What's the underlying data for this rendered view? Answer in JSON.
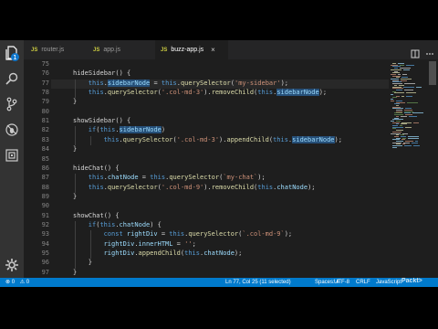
{
  "tabs": [
    {
      "icon": "JS",
      "label": "router.js",
      "active": false
    },
    {
      "icon": "JS",
      "label": "app.js",
      "active": false
    },
    {
      "icon": "JS",
      "label": "buzz-app.js",
      "active": true,
      "close": "×"
    }
  ],
  "activity_icons": [
    "files-icon",
    "search-icon",
    "git-icon",
    "debug-icon",
    "extensions-icon",
    "settings-gear-icon"
  ],
  "explorer_badge": "1",
  "editor": {
    "line_numbers": [
      "75",
      "76",
      "77",
      "78",
      "79",
      "80",
      "81",
      "82",
      "83",
      "84",
      "85",
      "86",
      "87",
      "88",
      "89",
      "90",
      "91",
      "92",
      "93",
      "94",
      "95",
      "96",
      "97"
    ],
    "lines": [
      [],
      [
        {
          "t": "hideSidebar() {",
          "c": "plain"
        }
      ],
      [
        {
          "t": "this",
          "c": "kw"
        },
        {
          "t": ".",
          "c": "plain"
        },
        {
          "t": "sidebarNode",
          "c": "hl"
        },
        {
          "t": " = ",
          "c": "plain"
        },
        {
          "t": "this",
          "c": "kw"
        },
        {
          "t": ".",
          "c": "plain"
        },
        {
          "t": "querySelector",
          "c": "fn"
        },
        {
          "t": "(",
          "c": "plain"
        },
        {
          "t": "'my-sidebar'",
          "c": "str"
        },
        {
          "t": ");",
          "c": "plain"
        }
      ],
      [
        {
          "t": "this",
          "c": "kw"
        },
        {
          "t": ".",
          "c": "plain"
        },
        {
          "t": "querySelector",
          "c": "fn"
        },
        {
          "t": "(",
          "c": "plain"
        },
        {
          "t": "'.col-md-3'",
          "c": "str"
        },
        {
          "t": ").",
          "c": "plain"
        },
        {
          "t": "removeChild",
          "c": "fn"
        },
        {
          "t": "(",
          "c": "plain"
        },
        {
          "t": "this",
          "c": "kw"
        },
        {
          "t": ".",
          "c": "plain"
        },
        {
          "t": "sidebarNode",
          "c": "hl"
        },
        {
          "t": ");",
          "c": "plain"
        }
      ],
      [
        {
          "t": "}",
          "c": "plain"
        }
      ],
      [],
      [
        {
          "t": "showSidebar() {",
          "c": "plain"
        }
      ],
      [
        {
          "t": "if",
          "c": "kw"
        },
        {
          "t": "(",
          "c": "plain"
        },
        {
          "t": "this",
          "c": "kw"
        },
        {
          "t": ".",
          "c": "plain"
        },
        {
          "t": "sidebarNode",
          "c": "hl"
        },
        {
          "t": ")",
          "c": "plain"
        }
      ],
      [
        {
          "t": "this",
          "c": "kw"
        },
        {
          "t": ".",
          "c": "plain"
        },
        {
          "t": "querySelector",
          "c": "fn"
        },
        {
          "t": "(",
          "c": "plain"
        },
        {
          "t": "'.col-md-3'",
          "c": "str"
        },
        {
          "t": ").",
          "c": "plain"
        },
        {
          "t": "appendChild",
          "c": "fn"
        },
        {
          "t": "(",
          "c": "plain"
        },
        {
          "t": "this",
          "c": "kw"
        },
        {
          "t": ".",
          "c": "plain"
        },
        {
          "t": "sidebarNode",
          "c": "hl"
        },
        {
          "t": ");",
          "c": "plain"
        }
      ],
      [
        {
          "t": "}",
          "c": "plain"
        }
      ],
      [],
      [
        {
          "t": "hideChat() {",
          "c": "plain"
        }
      ],
      [
        {
          "t": "this",
          "c": "kw"
        },
        {
          "t": ".",
          "c": "plain"
        },
        {
          "t": "chatNode",
          "c": "var"
        },
        {
          "t": " = ",
          "c": "plain"
        },
        {
          "t": "this",
          "c": "kw"
        },
        {
          "t": ".",
          "c": "plain"
        },
        {
          "t": "querySelector",
          "c": "fn"
        },
        {
          "t": "(",
          "c": "plain"
        },
        {
          "t": "`my-chat`",
          "c": "str"
        },
        {
          "t": ");",
          "c": "plain"
        }
      ],
      [
        {
          "t": "this",
          "c": "kw"
        },
        {
          "t": ".",
          "c": "plain"
        },
        {
          "t": "querySelector",
          "c": "fn"
        },
        {
          "t": "(",
          "c": "plain"
        },
        {
          "t": "'.col-md-9'",
          "c": "str"
        },
        {
          "t": ").",
          "c": "plain"
        },
        {
          "t": "removeChild",
          "c": "fn"
        },
        {
          "t": "(",
          "c": "plain"
        },
        {
          "t": "this",
          "c": "kw"
        },
        {
          "t": ".",
          "c": "plain"
        },
        {
          "t": "chatNode",
          "c": "var"
        },
        {
          "t": ");",
          "c": "plain"
        }
      ],
      [
        {
          "t": "}",
          "c": "plain"
        }
      ],
      [],
      [
        {
          "t": "showChat() {",
          "c": "plain"
        }
      ],
      [
        {
          "t": "if",
          "c": "kw"
        },
        {
          "t": "(",
          "c": "plain"
        },
        {
          "t": "this",
          "c": "kw"
        },
        {
          "t": ".",
          "c": "plain"
        },
        {
          "t": "chatNode",
          "c": "var"
        },
        {
          "t": ") {",
          "c": "plain"
        }
      ],
      [
        {
          "t": "const",
          "c": "kw"
        },
        {
          "t": " ",
          "c": "plain"
        },
        {
          "t": "rightDiv",
          "c": "var"
        },
        {
          "t": " = ",
          "c": "plain"
        },
        {
          "t": "this",
          "c": "kw"
        },
        {
          "t": ".",
          "c": "plain"
        },
        {
          "t": "querySelector",
          "c": "fn"
        },
        {
          "t": "(",
          "c": "plain"
        },
        {
          "t": "`.col-md-9`",
          "c": "str"
        },
        {
          "t": ");",
          "c": "plain"
        }
      ],
      [
        {
          "t": "rightDiv",
          "c": "var"
        },
        {
          "t": ".",
          "c": "plain"
        },
        {
          "t": "innerHTML",
          "c": "var"
        },
        {
          "t": " = ",
          "c": "plain"
        },
        {
          "t": "''",
          "c": "str"
        },
        {
          "t": ";",
          "c": "plain"
        }
      ],
      [
        {
          "t": "rightDiv",
          "c": "var"
        },
        {
          "t": ".",
          "c": "plain"
        },
        {
          "t": "appendChild",
          "c": "fn"
        },
        {
          "t": "(",
          "c": "plain"
        },
        {
          "t": "this",
          "c": "kw"
        },
        {
          "t": ".",
          "c": "plain"
        },
        {
          "t": "chatNode",
          "c": "var"
        },
        {
          "t": ");",
          "c": "plain"
        }
      ],
      [
        {
          "t": "}",
          "c": "plain"
        }
      ],
      [
        {
          "t": "}",
          "c": "plain"
        }
      ]
    ],
    "indent_levels": [
      0,
      1,
      2,
      2,
      1,
      0,
      1,
      2,
      3,
      1,
      0,
      1,
      2,
      2,
      1,
      0,
      1,
      2,
      3,
      3,
      3,
      2,
      1
    ]
  },
  "status": {
    "errors": "0",
    "warnings": "0",
    "position": "Ln 77, Col 25 (11 selected)",
    "spaces": "Spaces: 4",
    "encoding": "UTF-8",
    "eol": "CRLF",
    "language": "JavaScript",
    "watermark": "Packt>"
  },
  "colors": {
    "accent": "#007acc",
    "editor_bg": "#1e1e1e",
    "keyword": "#569cd6",
    "function": "#dcdcaa",
    "string": "#ce9178",
    "variable": "#9cdcfe",
    "selection_highlight": "#264f78"
  }
}
